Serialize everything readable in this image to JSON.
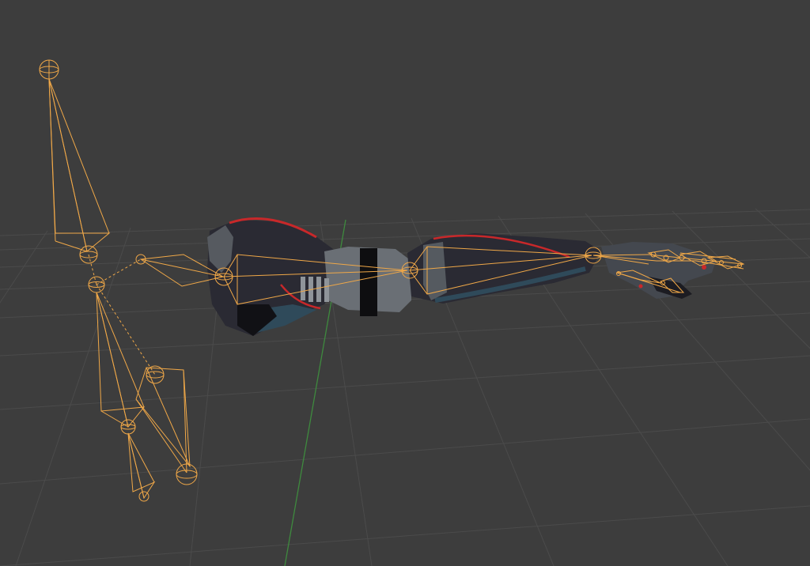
{
  "app": {
    "name": "3D viewport",
    "mode": "pose",
    "background_color": "#3d3d3d",
    "grid_color": "#4a4a4a",
    "y_axis_color": "#3a8a3a"
  },
  "scene": {
    "armature_color": "#f0a848",
    "mesh_body_color": "#252530",
    "mesh_grey_color": "#6a6f75",
    "mesh_accent_red": "#c8282a",
    "mesh_accent_blue": "#2f4a5a"
  }
}
